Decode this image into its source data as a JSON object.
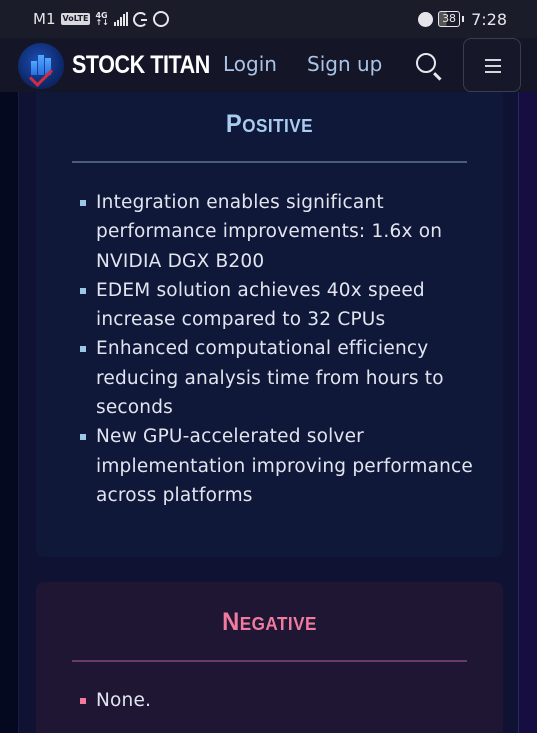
{
  "status_bar": {
    "carrier": "M1",
    "volte": "VoLTE",
    "network": "4G",
    "battery": "38",
    "time": "7:28",
    "icons": [
      "signal-icon",
      "g-icon",
      "whatsapp-icon",
      "alarm-icon",
      "battery-icon"
    ]
  },
  "header": {
    "brand": "STOCK TITAN",
    "nav": {
      "login": "Login",
      "signup": "Sign up"
    },
    "icons": {
      "search": "search-icon",
      "menu": "hamburger-menu-icon"
    }
  },
  "positive": {
    "title": "Positive",
    "items": [
      "Integration enables significant performance improvements: 1.6x on NVIDIA DGX B200",
      "EDEM solution achieves 40x speed increase compared to 32 CPUs",
      "Enhanced computational efficiency reducing analysis time from hours to seconds",
      "New GPU-accelerated solver implementation improving performance across platforms"
    ]
  },
  "negative": {
    "title": "Negative",
    "items": [
      "None."
    ]
  },
  "colors": {
    "positive_accent": "#a9cdf0",
    "negative_accent": "#f07b9f",
    "nav_link": "#a9c4e6"
  }
}
